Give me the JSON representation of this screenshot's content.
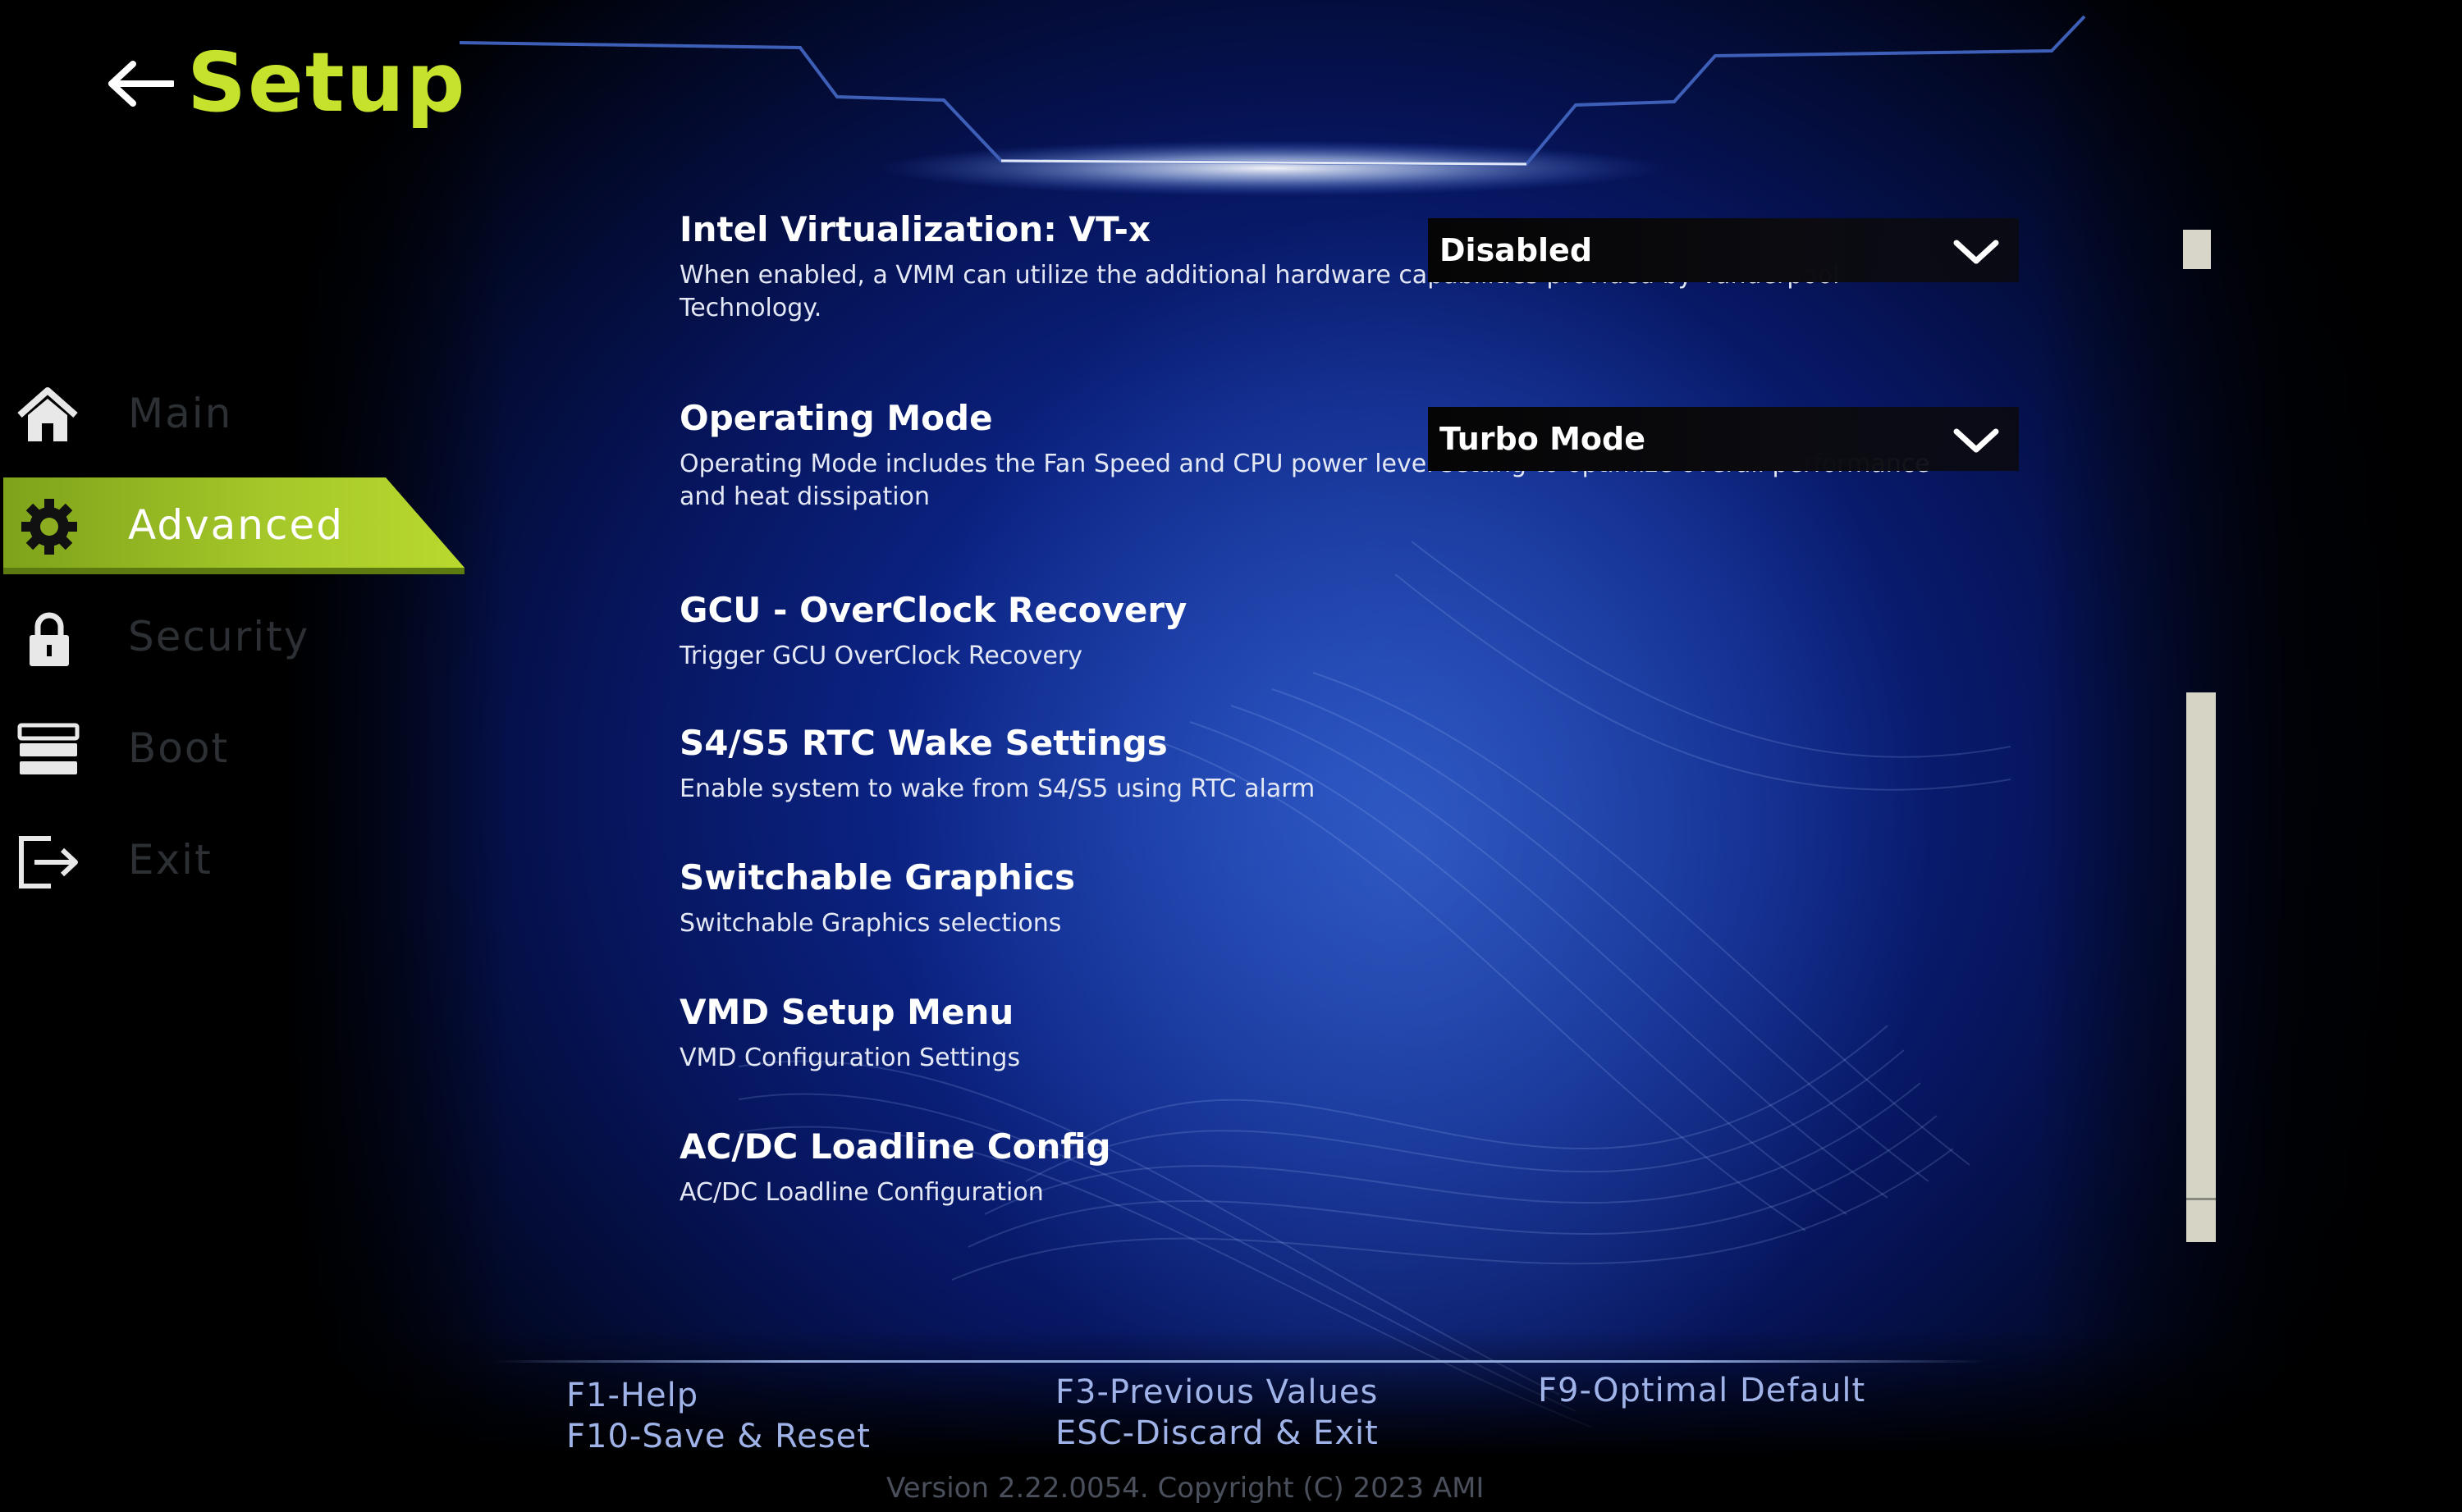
{
  "header": {
    "title": "Setup",
    "back_icon": "arrow-left-icon"
  },
  "colors": {
    "accent": "#c6e22c",
    "hint": "#9fb3e8"
  },
  "nav": {
    "items": [
      {
        "label": "Main",
        "icon": "home-icon",
        "active": false
      },
      {
        "label": "Advanced",
        "icon": "gear-icon",
        "active": true
      },
      {
        "label": "Security",
        "icon": "lock-icon",
        "active": false
      },
      {
        "label": "Boot",
        "icon": "stack-icon",
        "active": false
      },
      {
        "label": "Exit",
        "icon": "exit-icon",
        "active": false
      }
    ]
  },
  "settings": [
    {
      "title": "Intel Virtualization: VT-x",
      "value": "Disabled",
      "description": "When enabled, a VMM can utilize the additional hardware capabilities provided by Vanderpool Technology."
    },
    {
      "title": "Operating Mode",
      "value": "Turbo Mode",
      "description": "Operating Mode includes the Fan Speed and CPU power level setting to optimize overall performance and heat dissipation"
    },
    {
      "title": "GCU - OverClock Recovery",
      "description": "Trigger GCU OverClock Recovery"
    },
    {
      "title": "S4/S5 RTC Wake Settings",
      "description": "Enable system to wake from S4/S5 using RTC alarm"
    },
    {
      "title": "Switchable Graphics",
      "description": "Switchable Graphics selections"
    },
    {
      "title": "VMD Setup Menu",
      "description": "VMD Configuration Settings"
    },
    {
      "title": "AC/DC Loadline Config",
      "description": "AC/DC Loadline Configuration"
    }
  ],
  "footer": {
    "f1": "F1-Help",
    "f10": "F10-Save & Reset",
    "f3": "F3-Previous Values",
    "esc": "ESC-Discard & Exit",
    "f9": "F9-Optimal Default",
    "version": "Version 2.22.0054. Copyright (C) 2023 AMI"
  }
}
